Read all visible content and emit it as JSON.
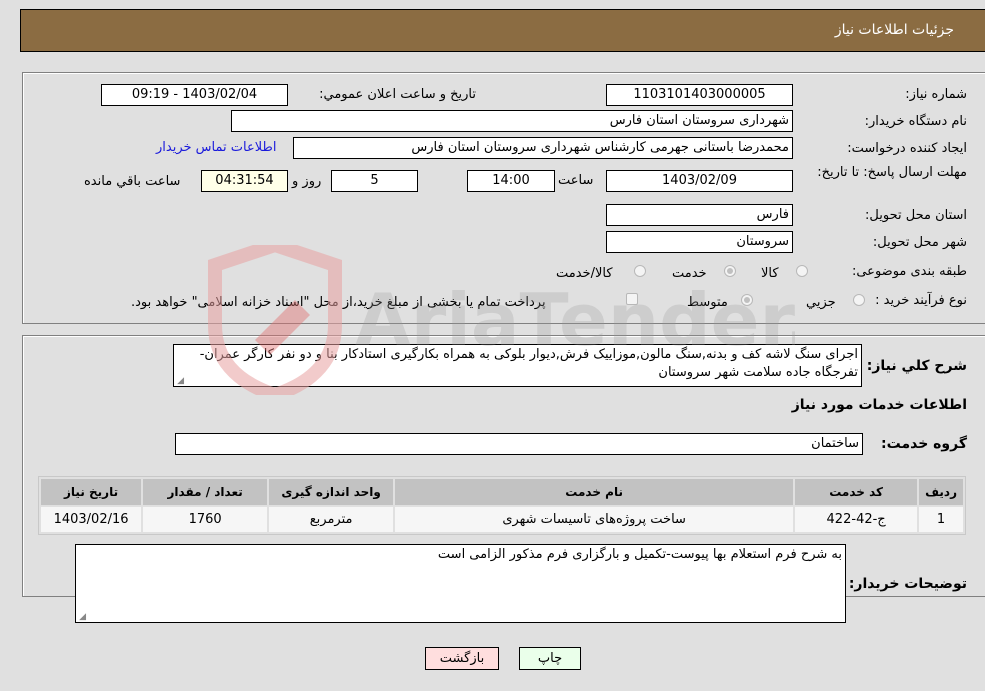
{
  "header": {
    "title": "جزئيات اطلاعات نياز"
  },
  "form": {
    "need_number": {
      "label": "شماره نياز:",
      "value": "1103101403000005"
    },
    "announce_datetime": {
      "label": "تاريخ و ساعت اعلان عمومي:",
      "value": "1403/02/04 - 09:19"
    },
    "buyer_org": {
      "label": "نام دستگاه خريدار:",
      "value": "شهرداری سروستان استان فارس"
    },
    "requester": {
      "label": "ايجاد کننده درخواست:",
      "value": "محمدرضا باستانی جهرمی کارشناس شهرداری سروستان استان فارس"
    },
    "buyer_contact_link": "اطلاعات تماس خريدار",
    "deadline": {
      "label": "مهلت ارسال پاسخ: تا تاريخ:",
      "date": "1403/02/09",
      "time_label": "ساعت",
      "time": "14:00",
      "days": "5",
      "days_label": "روز و",
      "remaining": "04:31:54",
      "remaining_label": "ساعت باقي مانده"
    },
    "delivery_province": {
      "label": "استان محل تحويل:",
      "value": "فارس"
    },
    "delivery_city": {
      "label": "شهر محل تحويل:",
      "value": "سروستان"
    },
    "category": {
      "label": "طبقه بندی موضوعی:",
      "options": [
        "کالا",
        "خدمت",
        "کالا/خدمت"
      ],
      "selected": "خدمت"
    },
    "purchase_process": {
      "label": "نوع فرآيند خريد :",
      "options": [
        "جزيي",
        "متوسط"
      ],
      "selected": "متوسط",
      "treasury_checkbox_label": "پرداخت تمام يا بخشی از مبلغ خريد،از محل \"اسناد خزانه اسلامی\" خواهد بود.",
      "treasury_checked": false
    }
  },
  "details": {
    "description_label": "شرح کلي نياز:",
    "description": "اجرای سنگ لاشه کف و بدنه,سنگ مالون,موزاييک فرش,ديوار بلوکی به همراه بکارگيری استادکار بنا و دو نفر کارگر عمران-تفرجگاه جاده سلامت شهر سروستان",
    "services_heading": "اطلاعات خدمات مورد نياز",
    "service_group_label": "گروه خدمت:",
    "service_group": "ساختمان",
    "table": {
      "headers": [
        "رديف",
        "کد خدمت",
        "نام خدمت",
        "واحد اندازه گيری",
        "تعداد / مقدار",
        "تاريخ نياز"
      ],
      "rows": [
        [
          "1",
          "ج-42-422",
          "ساخت پروژه‌های تاسيسات شهری",
          "مترمربع",
          "1760",
          "1403/02/16"
        ]
      ]
    },
    "buyer_notes_label": "توضيحات خريدار:",
    "buyer_notes": "به شرح فرم استعلام بها پيوست-تکميل و بارگزاری فرم مذکور الزامی است"
  },
  "buttons": {
    "print": "چاپ",
    "back": "بازگشت"
  },
  "colors": {
    "header_bg": "#8b6c42",
    "print_bg": "#eaffea",
    "back_bg": "#ffdede",
    "link": "#1a1adb"
  },
  "watermark": "AriaTender.neT"
}
